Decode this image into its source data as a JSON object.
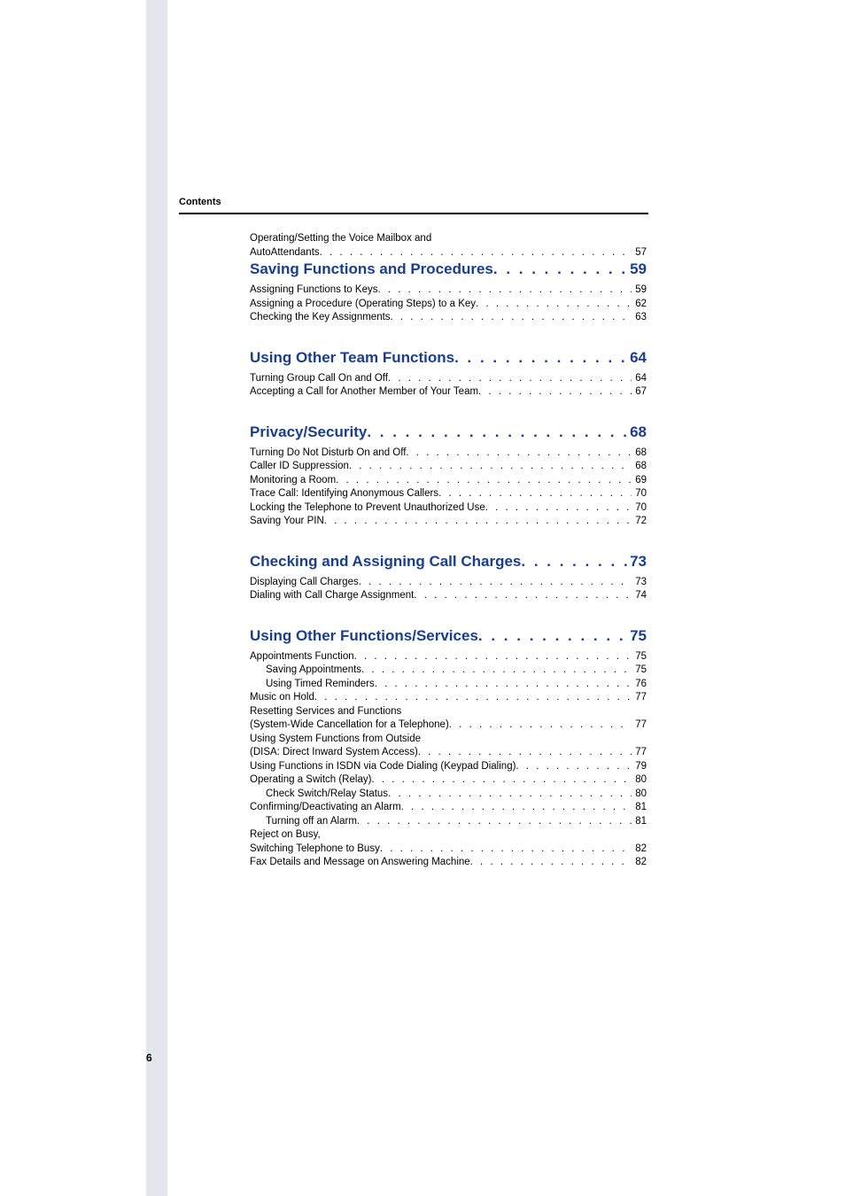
{
  "header": {
    "label": "Contents"
  },
  "pageNumber": "6",
  "intro": {
    "line1": "Operating/Setting the Voice Mailbox and",
    "entry": {
      "title": "AutoAttendants",
      "page": "57"
    }
  },
  "sections": [
    {
      "title": "Saving Functions and Procedures",
      "page": "59",
      "entries": [
        {
          "title": "Assigning Functions to Keys",
          "page": "59"
        },
        {
          "title": "Assigning a Procedure (Operating Steps) to a Key",
          "page": "62"
        },
        {
          "title": "Checking the Key Assignments",
          "page": "63"
        }
      ]
    },
    {
      "title": "Using Other Team Functions",
      "page": "64",
      "entries": [
        {
          "title": "Turning Group Call On and Off",
          "page": "64"
        },
        {
          "title": "Accepting a Call for Another Member of Your Team",
          "page": "67"
        }
      ]
    },
    {
      "title": "Privacy/Security",
      "page": "68",
      "entries": [
        {
          "title": "Turning Do Not Disturb On and Off",
          "page": "68"
        },
        {
          "title": "Caller ID Suppression",
          "page": "68"
        },
        {
          "title": "Monitoring a Room",
          "page": "69"
        },
        {
          "title": "Trace Call: Identifying Anonymous Callers",
          "page": "70"
        },
        {
          "title": "Locking the Telephone to Prevent Unauthorized Use",
          "page": "70"
        },
        {
          "title": "Saving Your PIN",
          "page": "72"
        }
      ]
    },
    {
      "title": "Checking and Assigning Call Charges",
      "page": "73",
      "entries": [
        {
          "title": "Displaying Call Charges",
          "page": "73"
        },
        {
          "title": "Dialing with Call Charge Assignment",
          "page": "74"
        }
      ]
    },
    {
      "title": "Using Other Functions/Services",
      "page": "75",
      "entries": [
        {
          "title": "Appointments Function",
          "page": "75"
        },
        {
          "title": "Saving Appointments",
          "page": "75",
          "indent": 1
        },
        {
          "title": "Using Timed Reminders",
          "page": "76",
          "indent": 1
        },
        {
          "title": "Music on Hold",
          "page": "77"
        },
        {
          "wrap": "Resetting Services and Functions"
        },
        {
          "title": "(System-Wide Cancellation for a Telephone)",
          "page": "77"
        },
        {
          "wrap": "Using System Functions from Outside"
        },
        {
          "title": "(DISA: Direct Inward System Access)",
          "page": "77"
        },
        {
          "title": "Using Functions in ISDN via Code Dialing (Keypad Dialing)",
          "page": "79"
        },
        {
          "title": "Operating a Switch (Relay)",
          "page": "80"
        },
        {
          "title": "Check Switch/Relay Status",
          "page": "80",
          "indent": 1
        },
        {
          "title": "Confirming/Deactivating an Alarm",
          "page": "81"
        },
        {
          "title": "Turning off an Alarm",
          "page": "81",
          "indent": 1
        },
        {
          "wrap": "Reject on Busy,"
        },
        {
          "title": "Switching Telephone to Busy",
          "page": "82"
        },
        {
          "title": "Fax Details and Message on Answering Machine",
          "page": "82"
        }
      ]
    }
  ]
}
